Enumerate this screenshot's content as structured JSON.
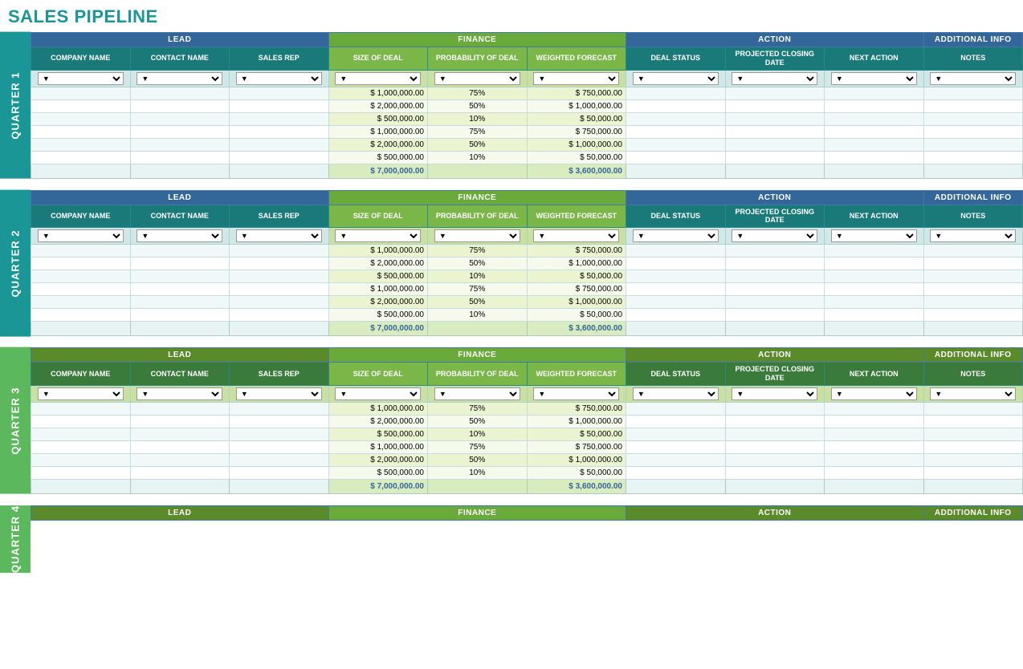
{
  "title": "SALES PIPELINE",
  "sections": {
    "lead_header": "LEAD",
    "finance_header": "FINANCE",
    "action_header": "ACTION",
    "additional_header": "ADDITIONAL INFO"
  },
  "columns": {
    "company_name": "COMPANY NAME",
    "contact_name": "CONTACT NAME",
    "sales_rep": "SALES REP",
    "size_of_deal": "SIZE OF DEAL",
    "probability_of_deal": "PROBABILITY OF DEAL",
    "weighted_forecast": "WEIGHTED FORECAST",
    "deal_status": "DEAL STATUS",
    "projected_closing_date": "PROJECTED CLOSING DATE",
    "next_action": "NEXT ACTION",
    "notes": "NOTES"
  },
  "quarters": [
    {
      "label": "QUARTER 1",
      "label_short": "Q1",
      "css_class": "q1-label",
      "rows": [
        {
          "deal_size": "$ 1,000,000.00",
          "probability": "75%",
          "weighted": "$ 750,000.00"
        },
        {
          "deal_size": "$ 2,000,000.00",
          "probability": "50%",
          "weighted": "$ 1,000,000.00"
        },
        {
          "deal_size": "$ 500,000.00",
          "probability": "10%",
          "weighted": "$ 50,000.00"
        },
        {
          "deal_size": "$ 1,000,000.00",
          "probability": "75%",
          "weighted": "$ 750,000.00"
        },
        {
          "deal_size": "$ 2,000,000.00",
          "probability": "50%",
          "weighted": "$ 1,000,000.00"
        },
        {
          "deal_size": "$ 500,000.00",
          "probability": "10%",
          "weighted": "$ 50,000.00"
        }
      ],
      "total_deal": "$ 7,000,000.00",
      "total_weighted": "$ 3,600,000.00"
    },
    {
      "label": "QUARTER 2",
      "label_short": "Q2",
      "css_class": "q2-label",
      "rows": [
        {
          "deal_size": "$ 1,000,000.00",
          "probability": "75%",
          "weighted": "$ 750,000.00"
        },
        {
          "deal_size": "$ 2,000,000.00",
          "probability": "50%",
          "weighted": "$ 1,000,000.00"
        },
        {
          "deal_size": "$ 500,000.00",
          "probability": "10%",
          "weighted": "$ 50,000.00"
        },
        {
          "deal_size": "$ 1,000,000.00",
          "probability": "75%",
          "weighted": "$ 750,000.00"
        },
        {
          "deal_size": "$ 2,000,000.00",
          "probability": "50%",
          "weighted": "$ 1,000,000.00"
        },
        {
          "deal_size": "$ 500,000.00",
          "probability": "10%",
          "weighted": "$ 50,000.00"
        }
      ],
      "total_deal": "$ 7,000,000.00",
      "total_weighted": "$ 3,600,000.00"
    },
    {
      "label": "QUARTER 3",
      "label_short": "Q3",
      "css_class": "q3-label",
      "rows": [
        {
          "deal_size": "$ 1,000,000.00",
          "probability": "75%",
          "weighted": "$ 750,000.00"
        },
        {
          "deal_size": "$ 2,000,000.00",
          "probability": "50%",
          "weighted": "$ 1,000,000.00"
        },
        {
          "deal_size": "$ 500,000.00",
          "probability": "10%",
          "weighted": "$ 50,000.00"
        },
        {
          "deal_size": "$ 1,000,000.00",
          "probability": "75%",
          "weighted": "$ 750,000.00"
        },
        {
          "deal_size": "$ 2,000,000.00",
          "probability": "50%",
          "weighted": "$ 1,000,000.00"
        },
        {
          "deal_size": "$ 500,000.00",
          "probability": "10%",
          "weighted": "$ 50,000.00"
        }
      ],
      "total_deal": "$ 7,000,000.00",
      "total_weighted": "$ 3,600,000.00"
    },
    {
      "label": "QUARTER 4",
      "label_short": "Q4",
      "css_class": "q4-label",
      "rows": [],
      "total_deal": "",
      "total_weighted": ""
    }
  ],
  "filter_placeholder": "▼"
}
